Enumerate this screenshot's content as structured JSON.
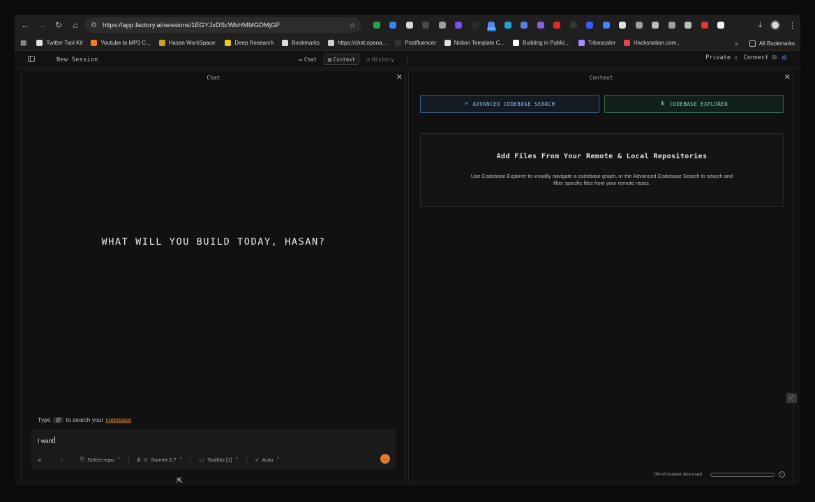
{
  "browser": {
    "url": "https://app.factory.ai/sessions/1EGYJxDScWbHMMGDMjGF",
    "nav": {
      "back": "←",
      "forward": "→",
      "reload": "↻",
      "home": "⌂"
    },
    "extensions": [
      {
        "name": "ext-green",
        "color": "#2e9e4f"
      },
      {
        "name": "ext-blue",
        "color": "#3b82f6"
      },
      {
        "name": "ext-pen",
        "color": "#d9d9d9"
      },
      {
        "name": "ext-dark",
        "color": "#4a4a4a"
      },
      {
        "name": "ext-gray",
        "color": "#9aa0a6"
      },
      {
        "name": "ext-purple",
        "color": "#7c4dff"
      },
      {
        "name": "ext-black",
        "color": "#2b2b2b"
      },
      {
        "name": "ext-badge",
        "color": "#4f86f7"
      },
      {
        "name": "ext-cyan",
        "color": "#29a3d6"
      },
      {
        "name": "ext-blue2",
        "color": "#5b7fe0"
      },
      {
        "name": "ext-violet",
        "color": "#8a63d2"
      },
      {
        "name": "ext-red",
        "color": "#d93025"
      },
      {
        "name": "ext-dim",
        "color": "#333333"
      },
      {
        "name": "ext-navy",
        "color": "#3d5afe"
      },
      {
        "name": "ext-sky",
        "color": "#4285f4"
      },
      {
        "name": "ext-white",
        "color": "#e0e0e0"
      },
      {
        "name": "ext-vs",
        "color": "#9e9e9e"
      },
      {
        "name": "ext-drop",
        "color": "#bdbdbd"
      },
      {
        "name": "ext-gray2",
        "color": "#9e9e9e"
      },
      {
        "name": "ext-camera",
        "color": "#bdbdbd"
      },
      {
        "name": "ext-red2",
        "color": "#e53935"
      },
      {
        "name": "ext-d",
        "color": "#f5f5f5"
      }
    ],
    "badge_text": "9695",
    "bookmarks": [
      {
        "label": "Twitter Tool Kit",
        "color": "#e0e0e0"
      },
      {
        "label": "Youtube to MP3 C...",
        "color": "#ff7a1a"
      },
      {
        "label": "Hasan WorkSpace:",
        "color": "#c9a227"
      },
      {
        "label": "Deep Research",
        "color": "#f0c419"
      },
      {
        "label": "Bookmarks",
        "color": "#dddddd"
      },
      {
        "label": "https://chat.opena...",
        "color": "#cfcfcf"
      },
      {
        "label": "Postfluencer",
        "color": "#333333"
      },
      {
        "label": "Notion Template C...",
        "color": "#e0e0e0"
      },
      {
        "label": "Building in Public...",
        "color": "#ffffff"
      },
      {
        "label": "Tribescaler",
        "color": "#a78bfa"
      },
      {
        "label": "Hacksnation.com...",
        "color": "#ef4444"
      }
    ],
    "bookmarks_more": "»",
    "all_bookmarks": "All Bookmarks"
  },
  "app": {
    "session_title": "New Session",
    "tabs": [
      {
        "label": "Chat",
        "icon": "chat-icon"
      },
      {
        "label": "Context",
        "icon": "context-icon"
      },
      {
        "label": "History",
        "icon": "history-icon"
      }
    ],
    "private_label": "Private",
    "connect_label": "Connect"
  },
  "chat": {
    "title": "Chat",
    "hero": "WHAT WILL YOU BUILD TODAY, HASAN?",
    "hint_prefix": "Type",
    "hint_at": "@",
    "hint_middle": "to search your",
    "hint_link": "codebase",
    "input_value": "I want",
    "controls": {
      "select_repo": "Select repo",
      "model": "Sonnet 3.7",
      "toolkits": "Toolkits [1]",
      "auto": "Auto"
    }
  },
  "context": {
    "title": "Context",
    "search_button": "ADVANCED CODEBASE SEARCH",
    "explorer_button": "CODEBASE EXPLORER",
    "card_title": "Add Files From Your Remote & Local Repositories",
    "card_text": "Use Codebase Explorer to visually navigate a codebase graph, or the Advanced Codebase Search to search and filter specific files from your remote repos.",
    "usage_label": "0% of context size used",
    "usage_fraction": 0
  }
}
